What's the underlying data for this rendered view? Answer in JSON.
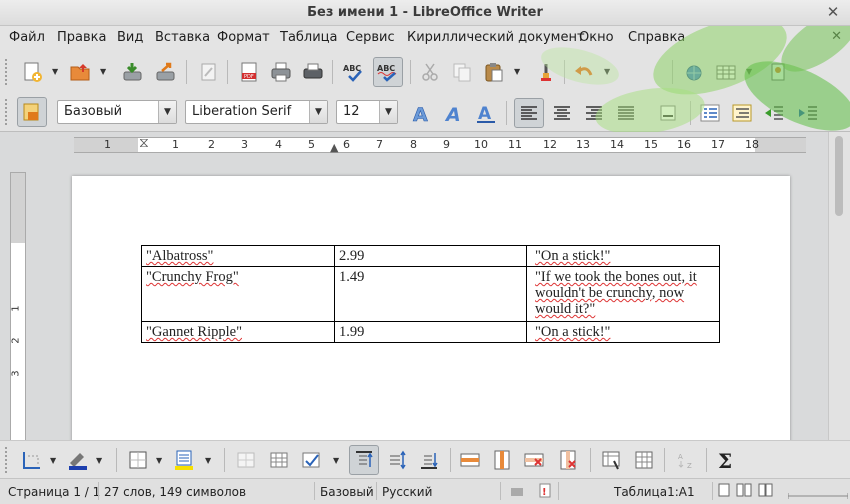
{
  "window": {
    "title": "Без имени 1 - LibreOffice Writer",
    "close_glyph": "✕"
  },
  "menu": {
    "items": [
      "Файл",
      "Правка",
      "Вид",
      "Вставка",
      "Формат",
      "Таблица",
      "Сервис",
      "Кириллический документ",
      "Окно",
      "Справка"
    ],
    "close_glyph": "✕"
  },
  "formatting": {
    "paragraph_style": "Базовый",
    "font_name": "Liberation Serif",
    "font_size": "12"
  },
  "ruler": {
    "numbers": [
      "1",
      "1",
      "1",
      "2",
      "3",
      "4",
      "5",
      "6",
      "7",
      "8",
      "9",
      "10",
      "11",
      "12",
      "13",
      "14",
      "15",
      "16",
      "17",
      "18"
    ]
  },
  "vertical_ruler": {
    "numbers": [
      "1",
      "2",
      "3"
    ]
  },
  "table": {
    "rows": [
      [
        "\"Albatross\"",
        "2.99",
        "\"On a stick!\""
      ],
      [
        "\"Crunchy Frog\"",
        "1.49",
        "\"If we took the bones out, it wouldn't be crunchy, now would it?\""
      ],
      [
        "\"Gannet Ripple\"",
        "1.99",
        "\"On a stick!\""
      ]
    ]
  },
  "status": {
    "page": "Страница 1 / 1",
    "words": "27 слов, 149 символов",
    "style": "Базовый",
    "language": "Русский",
    "table_cell": "Таблица1:A1"
  },
  "colors": {
    "leaf_green": "#6cc24a",
    "accent_blue": "#2a63b8",
    "spell_red": "#dd3333"
  },
  "icons": {
    "toolbar1": [
      "new-document-icon",
      "open-icon",
      "save-icon",
      "export-icon",
      "edit-mode-icon",
      "export-pdf-icon",
      "print-icon",
      "print-preview-icon",
      "spellcheck-icon",
      "autospellcheck-icon",
      "cut-icon",
      "copy-icon",
      "paste-icon",
      "clone-formatting-icon",
      "undo-icon",
      "navigator-icon",
      "table-icon",
      "image-icon"
    ],
    "toolbar2": [
      "styles-icon",
      "shadowed-a-icon",
      "italic-a-icon",
      "underline-a-icon",
      "align-left-icon",
      "align-center-icon",
      "align-right-icon",
      "justify-icon",
      "paragraph-icon",
      "list-icon",
      "list-level-icon",
      "indent-decrease-icon",
      "indent-increase-icon"
    ]
  }
}
